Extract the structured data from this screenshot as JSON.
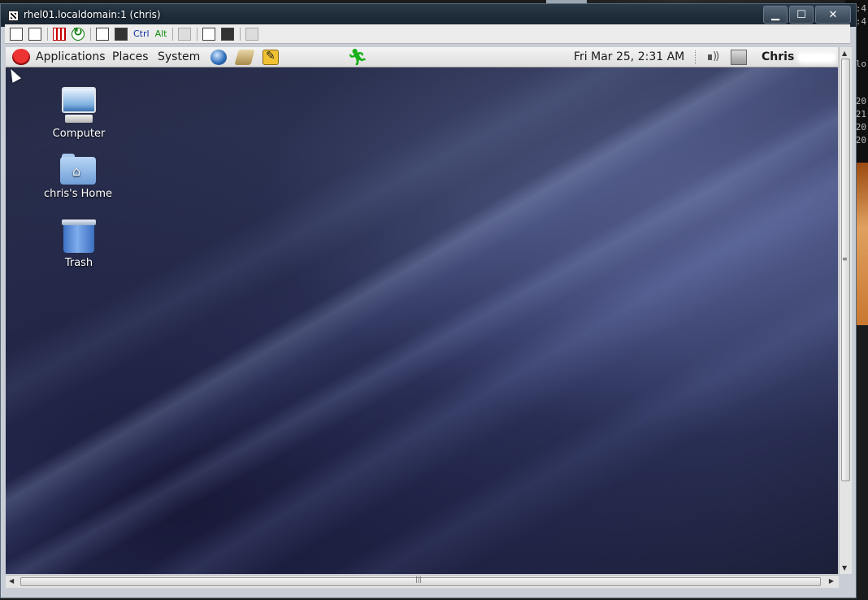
{
  "background_terminal": {
    "lines": [
      ":4",
      ":4",
      "lo",
      "20",
      "21",
      "20",
      "20"
    ]
  },
  "window": {
    "title": "rhel01.localdomain:1 (chris)",
    "controls": {
      "minimize": "▁",
      "maximize": "☐",
      "close": "✕"
    }
  },
  "toolbar": {
    "icons": [
      "options-icon",
      "info-icon",
      "fullscreen-icon",
      "refresh-icon",
      "send-keys-icon",
      "ctrl-alt-del-icon"
    ],
    "ctrl_label": "Ctrl",
    "alt_label": "Alt",
    "more_icons": [
      "copy-icon",
      "transfer-icon",
      "save-icon",
      "scale-icon"
    ]
  },
  "panel": {
    "menu": [
      "Applications",
      "Places",
      "System"
    ],
    "launchers": [
      "web-browser-icon",
      "mail-icon",
      "notes-icon",
      "runner-icon"
    ],
    "clock": "Fri Mar 25,  2:31 AM",
    "user": "Chris"
  },
  "desktop": {
    "icons": [
      {
        "label": "Computer",
        "icon": "computer-icon"
      },
      {
        "label": "chris's Home",
        "icon": "home-folder-icon"
      },
      {
        "label": "Trash",
        "icon": "trash-icon"
      }
    ]
  },
  "colors": {
    "titlebar": "#1d2a38",
    "panel": "#e8e8e8",
    "desktop_base": "#2e3558",
    "runner_green": "#19b019"
  }
}
